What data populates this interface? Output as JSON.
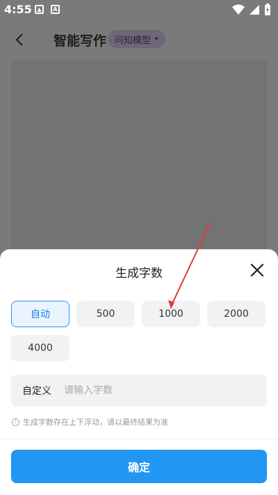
{
  "status_bar": {
    "time": "4:55",
    "icons": [
      "image-icon",
      "a-letter-icon",
      "wifi-icon",
      "signal-icon",
      "battery-charging-icon"
    ],
    "a_icon_text": "A"
  },
  "header": {
    "title": "智能写作",
    "model_pill": "问知模型"
  },
  "sheet": {
    "title": "生成字数",
    "options": [
      {
        "label": "自动",
        "selected": true
      },
      {
        "label": "500",
        "selected": false
      },
      {
        "label": "1000",
        "selected": false
      },
      {
        "label": "2000",
        "selected": false
      },
      {
        "label": "4000",
        "selected": false
      }
    ],
    "custom": {
      "label": "自定义",
      "placeholder": "请输入字数",
      "value": ""
    },
    "hint": "生成字数存在上下浮动，请以最终结果为准",
    "info_icon_text": "i",
    "confirm_label": "确定"
  },
  "colors": {
    "accent": "#2196f3",
    "selected_border": "#2f8ff0",
    "annotation_arrow": "#e53935"
  }
}
